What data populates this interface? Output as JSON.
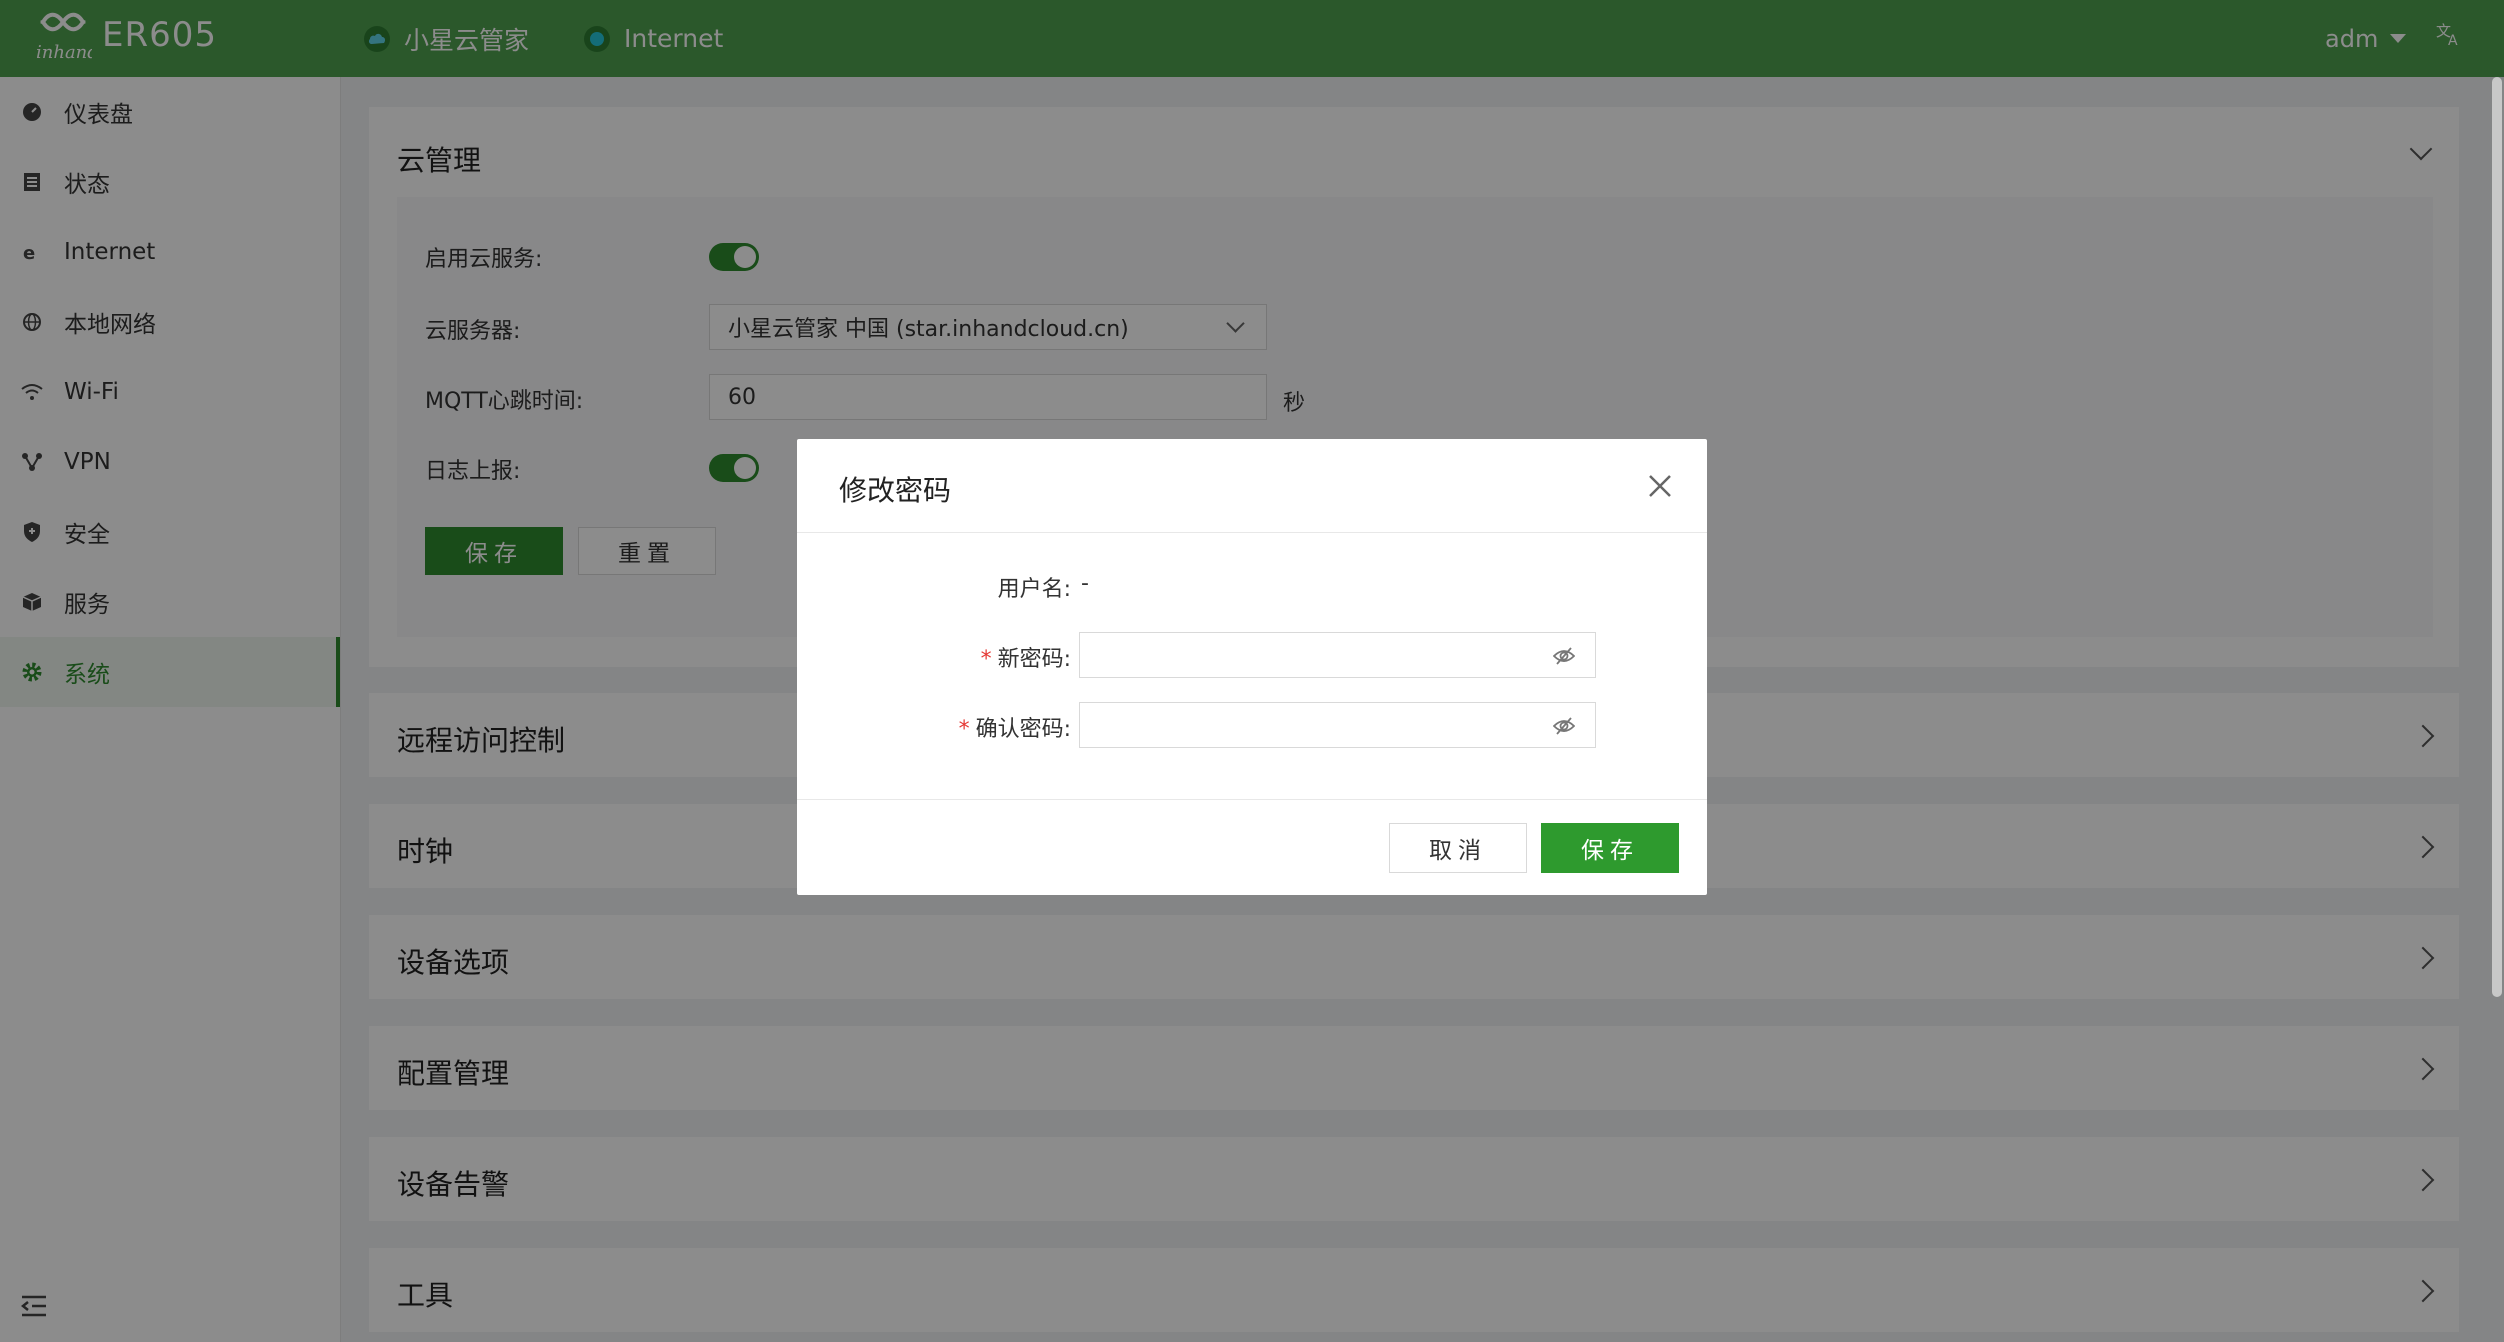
{
  "header": {
    "brand": "ER605",
    "cloud_label": "小星云管家",
    "internet_label": "Internet",
    "user": "adm",
    "lang_icon": "translate-icon"
  },
  "sidebar": {
    "items": [
      {
        "label": "仪表盘",
        "icon": "dashboard-icon"
      },
      {
        "label": "状态",
        "icon": "status-icon"
      },
      {
        "label": "Internet",
        "icon": "internet-icon"
      },
      {
        "label": "本地网络",
        "icon": "globe-icon"
      },
      {
        "label": "Wi-Fi",
        "icon": "wifi-icon"
      },
      {
        "label": "VPN",
        "icon": "vpn-icon"
      },
      {
        "label": "安全",
        "icon": "shield-icon"
      },
      {
        "label": "服务",
        "icon": "box-icon"
      },
      {
        "label": "系统",
        "icon": "gear-icon"
      }
    ],
    "active": "系统"
  },
  "cloud_panel": {
    "title": "云管理",
    "enable_label": "启用云服务:",
    "server_label": "云服务器:",
    "server_value": "小星云管家 中国 (star.inhandcloud.cn)",
    "mqtt_label": "MQTT心跳时间:",
    "mqtt_value": "60",
    "mqtt_unit": "秒",
    "log_label": "日志上报:",
    "save": "保存",
    "reset": "重置"
  },
  "panels": [
    "远程访问控制",
    "时钟",
    "设备选项",
    "配置管理",
    "设备告警",
    "工具"
  ],
  "modal": {
    "title": "修改密码",
    "username_label": "用户名:",
    "username_value": "-",
    "new_pwd_label": "新密码:",
    "confirm_pwd_label": "确认密码:",
    "cancel": "取消",
    "save": "保存"
  },
  "colors": {
    "brand": "#4fa14f",
    "primary": "#2e8b2e"
  }
}
